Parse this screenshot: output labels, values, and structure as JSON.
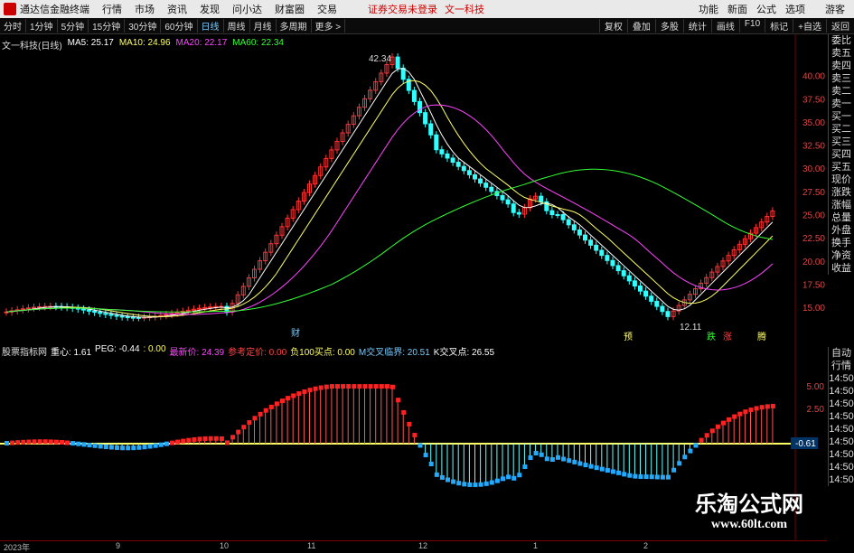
{
  "titlebar": {
    "app_name": "通达信金融终端",
    "menus": [
      "行情",
      "市场",
      "资讯",
      "发现",
      "问小达",
      "财富圈",
      "交易"
    ],
    "status": "证券交易未登录",
    "stock": "文一科技",
    "right": [
      "功能",
      "新面",
      "公式",
      "选项"
    ],
    "guest": "游客"
  },
  "toolbar": {
    "timeframes": [
      "分时",
      "1分钟",
      "5分钟",
      "15分钟",
      "30分钟",
      "60分钟",
      "日线",
      "周线",
      "月线",
      "多周期",
      "更多 >"
    ],
    "active_index": 6,
    "right": [
      "复权",
      "叠加",
      "多股",
      "统计",
      "画线",
      "F10",
      "标记",
      "+自选",
      "返回"
    ]
  },
  "main_header": {
    "title": "文一科技(日线)",
    "ma5": "MA5: 25.17",
    "ma10": "MA10: 24.96",
    "ma20": "MA20: 22.17",
    "ma60": "MA60: 22.34"
  },
  "price_axis": [
    "40.00",
    "37.50",
    "35.00",
    "32.50",
    "30.00",
    "27.50",
    "25.00",
    "22.50",
    "20.00",
    "17.50",
    "15.00"
  ],
  "annotations": {
    "high": "42.34",
    "low": "12.11",
    "cai": "财",
    "yu": "预",
    "die": "跌",
    "zhang": "涨",
    "teng": "腾"
  },
  "sub_header": {
    "name": "股票指标网",
    "zhongxin": "重心: 1.61",
    "peg": "PEG: -0.44",
    "zero": ": 0.00",
    "latest": "最新价: 24.39",
    "valuation": "参考定价: 0.00",
    "buy": "负100买点: 0.00",
    "mcross": "M交叉临界: 20.51",
    "kcross": "K交叉点: 26.55"
  },
  "sub_axis": [
    "5.00",
    "2.50",
    "-0.61"
  ],
  "right_panel": [
    "委比",
    "卖五",
    "卖四",
    "卖三",
    "卖二",
    "卖一",
    "买一",
    "买二",
    "买三",
    "买四",
    "买五",
    "现价",
    "涨跌",
    "涨幅",
    "总量",
    "外盘",
    "换手",
    "净资",
    "收益"
  ],
  "right_panel2": [
    "自动",
    "行情",
    "14:50",
    "14:50",
    "14:50",
    "14:50",
    "14:50",
    "14:50",
    "14:50",
    "14:50",
    "14:50"
  ],
  "time_axis": [
    "2023年",
    "9",
    "10",
    "11",
    "12",
    "1",
    "2"
  ],
  "watermark": {
    "line1": "乐淘公式网",
    "line2": "www.60lt.com"
  },
  "colors": {
    "up": "#ff3333",
    "down": "#33ffff",
    "ma5": "#ffffff",
    "ma10": "#ffff66",
    "ma20": "#ff44ff",
    "ma60": "#33ff33"
  }
}
